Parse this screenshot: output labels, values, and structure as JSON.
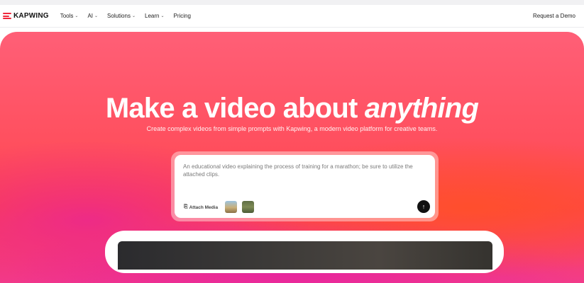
{
  "brand": {
    "name": "KAPWING",
    "accent": "#f0283c"
  },
  "nav": {
    "items": [
      {
        "label": "Tools",
        "has_menu": true
      },
      {
        "label": "AI",
        "has_menu": true
      },
      {
        "label": "Solutions",
        "has_menu": true
      },
      {
        "label": "Learn",
        "has_menu": true
      },
      {
        "label": "Pricing",
        "has_menu": false
      }
    ],
    "chevron": "⌄",
    "cta": "Request a Demo"
  },
  "hero": {
    "headline_main": "Make a video about ",
    "headline_em": "anything",
    "subheadline": "Create complex videos from simple prompts with Kapwing, a modern video platform for creative teams.",
    "prompt": {
      "text": "An educational video explaining the process of training for a marathon; be sure to utilize the attached clips.",
      "attach_label": "Attach Media",
      "attach_icon": "paperclip-icon",
      "send_icon": "arrow-up-icon"
    }
  }
}
